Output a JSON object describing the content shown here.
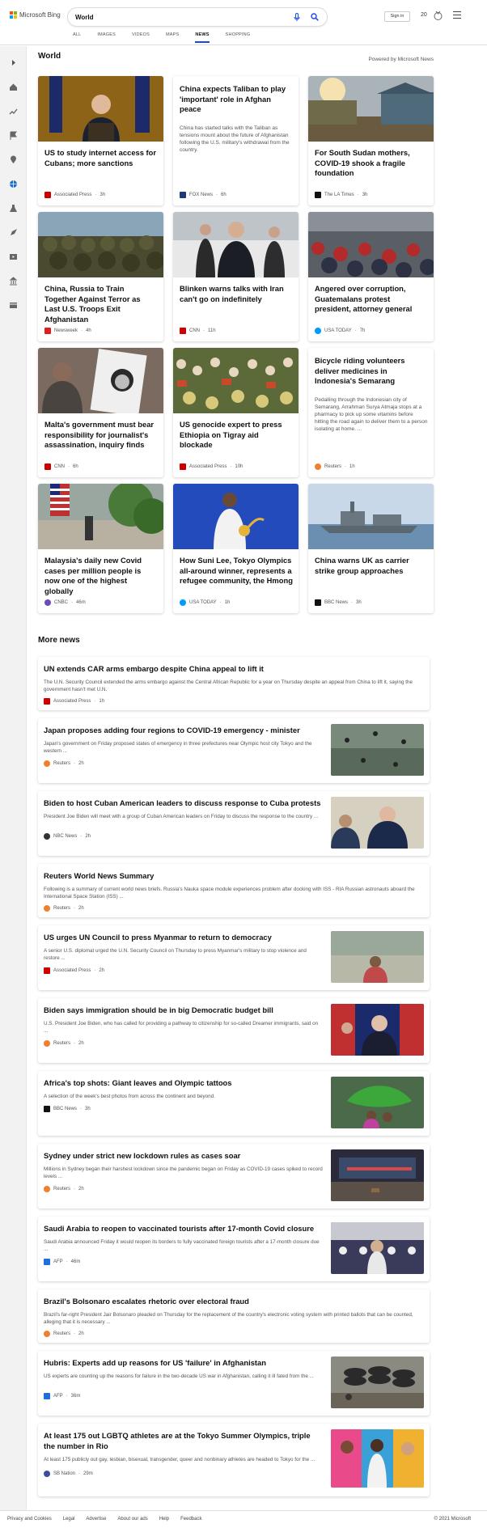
{
  "header": {
    "brand": "Microsoft Bing",
    "search_value": "World",
    "sign_in": "Sign in",
    "rewards_count": "20",
    "tabs": [
      {
        "label": "ALL",
        "active": false
      },
      {
        "label": "IMAGES",
        "active": false
      },
      {
        "label": "VIDEOS",
        "active": false
      },
      {
        "label": "MAPS",
        "active": false
      },
      {
        "label": "NEWS",
        "active": true
      },
      {
        "label": "SHOPPING",
        "active": false
      }
    ],
    "colors": {
      "accent": "#174ae4",
      "ms_red": "#f25022",
      "ms_green": "#7fba00",
      "ms_blue": "#00a4ef",
      "ms_yellow": "#ffb900"
    }
  },
  "sidebar": {
    "icons": [
      "expand-icon",
      "home-icon",
      "trending-icon",
      "flag-icon",
      "location-icon",
      "globe-icon",
      "flask-icon",
      "rocket-icon",
      "video-icon",
      "building-icon",
      "card-icon"
    ]
  },
  "section": {
    "title": "World",
    "powered": "Powered by Microsoft News"
  },
  "cards": [
    {
      "title": "US to study internet access for Cubans; more sanctions",
      "snippet": "",
      "source": "Associated Press",
      "time": "3h",
      "source_color": "#c00"
    },
    {
      "title": "China expects Taliban to play 'important' role in Afghan peace",
      "snippet": "China has started talks with the Taliban as tensions mount about the future of Afghanistan following the U.S. military's withdrawal from the country.",
      "source": "FOX News",
      "time": "6h",
      "source_color": "#1c3a7a"
    },
    {
      "title": "For South Sudan mothers, COVID-19 shook a fragile foundation",
      "snippet": "",
      "source": "The LA Times",
      "time": "3h",
      "source_color": "#111"
    },
    {
      "title": "China, Russia to Train Together Against Terror as Last U.S. Troops Exit Afghanistan",
      "snippet": "",
      "source": "Newsweek",
      "time": "4h",
      "source_color": "#e01b22"
    },
    {
      "title": "Blinken warns talks with Iran can't go on indefinitely",
      "snippet": "",
      "source": "CNN",
      "time": "11h",
      "source_color": "#cc0000"
    },
    {
      "title": "Angered over corruption, Guatemalans protest president, attorney general",
      "snippet": "",
      "source": "USA TODAY",
      "time": "7h",
      "source_color": "#009bff"
    },
    {
      "title": "Malta's government must bear responsibility for journalist's assassination, inquiry finds",
      "snippet": "",
      "source": "CNN",
      "time": "6h",
      "source_color": "#cc0000"
    },
    {
      "title": "US genocide expert to press Ethiopia on Tigray aid blockade",
      "snippet": "",
      "source": "Associated Press",
      "time": "10h",
      "source_color": "#c00"
    },
    {
      "title": "Bicycle riding volunteers deliver medicines in Indonesia's Semarang",
      "snippet": "Pedalling through the Indonesian city of Semarang, Arrahman Surya Atmaja stops at a pharmacy to pick up some vitamins before hitting the road again to deliver them to a person isolating at home. ...",
      "source": "Reuters",
      "time": "1h",
      "source_color": "#f08030"
    },
    {
      "title": "Malaysia's daily new Covid cases per million people is now one of the highest globally",
      "snippet": "",
      "source": "CNBC",
      "time": "46m",
      "source_color": "#6e4cb5"
    },
    {
      "title": "How Suni Lee, Tokyo Olympics all-around winner, represents a refugee community, the Hmong",
      "snippet": "",
      "source": "USA TODAY",
      "time": "1h",
      "source_color": "#009bff"
    },
    {
      "title": "China warns UK as carrier strike group approaches",
      "snippet": "",
      "source": "BBC News",
      "time": "3h",
      "source_color": "#111"
    }
  ],
  "more": {
    "title": "More news",
    "items": [
      {
        "title": "UN extends CAR arms embargo despite China appeal to lift it",
        "snippet": "The U.N. Security Council extended the arms embargo against the Central African Republic for a year on Thursday despite an appeal from China to lift it, saying the government hasn't met U.N.",
        "source": "Associated Press",
        "time": "1h",
        "source_color": "#c00"
      },
      {
        "title": "Japan proposes adding four regions to COVID-19 emergency - minister",
        "snippet": "Japan's government on Friday proposed states of emergency in three prefectures near Olympic host city Tokyo and the western ...",
        "source": "Reuters",
        "time": "2h",
        "source_color": "#f08030"
      },
      {
        "title": "Biden to host Cuban American leaders to discuss response to Cuba protests",
        "snippet": "President Joe Biden will meet with a group of Cuban American leaders on Friday to discuss the response to the country ...",
        "source": "NBC News",
        "time": "2h",
        "source_color": "#333"
      },
      {
        "title": "Reuters World News Summary",
        "snippet": "Following is a summary of current world news briefs. Russia's Nauka space module experiences problem after docking with ISS - RIA Russian astronauts aboard the International Space Station (ISS) ...",
        "source": "Reuters",
        "time": "2h",
        "source_color": "#f08030"
      },
      {
        "title": "US urges UN Council to press Myanmar to return to democracy",
        "snippet": "A senior U.S. diplomat urged the U.N. Security Council on Thursday to press Myanmar's military to stop violence and restore ...",
        "source": "Associated Press",
        "time": "2h",
        "source_color": "#c00"
      },
      {
        "title": "Biden says immigration should be in big Democratic budget bill",
        "snippet": "U.S. President Joe Biden, who has called for providing a pathway to citizenship for so-called Dreamer immigrants, said on ...",
        "source": "Reuters",
        "time": "2h",
        "source_color": "#f08030"
      },
      {
        "title": "Africa's top shots: Giant leaves and Olympic tattoos",
        "snippet": "A selection of the week's best photos from across the continent and beyond.",
        "source": "BBC News",
        "time": "3h",
        "source_color": "#111"
      },
      {
        "title": "Sydney under strict new lockdown rules as cases soar",
        "snippet": "Millions in Sydney began their harshest lockdown since the pandemic began on Friday as COVID-19 cases spiked to record levels ...",
        "source": "Reuters",
        "time": "2h",
        "source_color": "#f08030"
      },
      {
        "title": "Saudi Arabia to reopen to vaccinated tourists after 17-month Covid closure",
        "snippet": "Saudi Arabia announced Friday it would reopen its borders to fully vaccinated foreign tourists after a 17-month closure due ...",
        "source": "AFP",
        "time": "46m",
        "source_color": "#1e6fd9"
      },
      {
        "title": "Brazil's Bolsonaro escalates rhetoric over electoral fraud",
        "snippet": "Brazil's far-right President Jair Bolsonaro pleaded on Thursday for the replacement of the country's electronic voting system with printed ballots that can be counted, alleging that it is necessary ...",
        "source": "Reuters",
        "time": "2h",
        "source_color": "#f08030"
      },
      {
        "title": "Hubris: Experts add up reasons for US 'failure' in Afghanistan",
        "snippet": "US experts are counting up the reasons for failure in the two-decade US war in Afghanistan, calling it ill fated from the ...",
        "source": "AFP",
        "time": "36m",
        "source_color": "#1e6fd9"
      },
      {
        "title": "At least 175 out LGBTQ athletes are at the Tokyo Summer Olympics, triple the number in Rio",
        "snippet": "At least 175 publicly out gay, lesbian, bisexual, transgender, queer and nonbinary athletes are headed to Tokyo for the ...",
        "source": "SB Nation",
        "time": "29m",
        "source_color": "#3a4fa0"
      }
    ]
  },
  "footer": {
    "links": [
      "Privacy and Cookies",
      "Legal",
      "Advertise",
      "About our ads",
      "Help",
      "Feedback"
    ],
    "copyright": "© 2021 Microsoft"
  }
}
